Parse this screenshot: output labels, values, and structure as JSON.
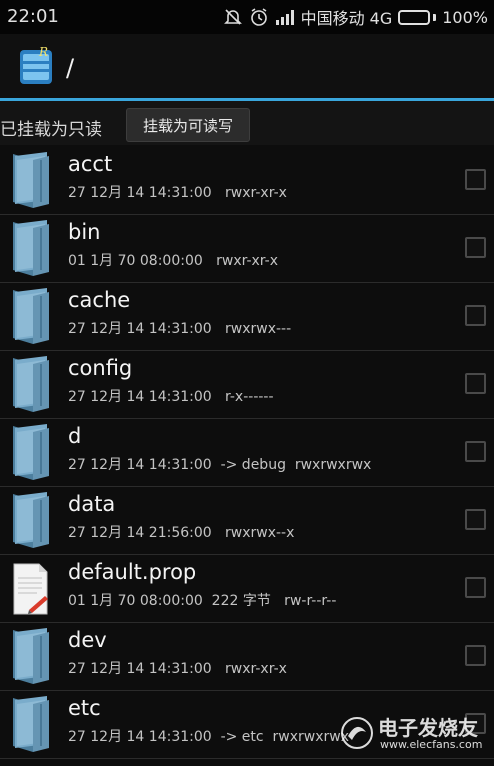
{
  "status_bar": {
    "time": "22:01",
    "carrier": "中国移动 4G",
    "battery": "100%",
    "battery_level": 1.0,
    "battery_color": "#3ad43a",
    "icons": [
      "no-alarm-icon",
      "clock-icon",
      "signal-icon",
      "battery-icon"
    ]
  },
  "title_bar": {
    "path": "/",
    "app_icon": "root-explorer-app-icon"
  },
  "mount_bar": {
    "status": "已挂载为只读",
    "button": "挂载为可读写"
  },
  "files": [
    {
      "name": "acct",
      "meta": "27 12月 14 14:31:00   rwxr-xr-x",
      "icon": "folder-icon"
    },
    {
      "name": "bin",
      "meta": "01 1月 70 08:00:00   rwxr-xr-x",
      "icon": "folder-icon"
    },
    {
      "name": "cache",
      "meta": "27 12月 14 14:31:00   rwxrwx---",
      "icon": "folder-icon"
    },
    {
      "name": "config",
      "meta": "27 12月 14 14:31:00   r-x------",
      "icon": "folder-icon"
    },
    {
      "name": "d",
      "meta": "27 12月 14 14:31:00  -> debug  rwxrwxrwx",
      "icon": "folder-icon"
    },
    {
      "name": "data",
      "meta": "27 12月 14 21:56:00   rwxrwx--x",
      "icon": "folder-icon"
    },
    {
      "name": "default.prop",
      "meta": "01 1月 70 08:00:00  222 字节   rw-r--r--",
      "icon": "file-icon"
    },
    {
      "name": "dev",
      "meta": "27 12月 14 14:31:00   rwxr-xr-x",
      "icon": "folder-icon"
    },
    {
      "name": "etc",
      "meta": "27 12月 14 14:31:00  -> etc  rwxrwxrwx",
      "icon": "folder-icon"
    }
  ],
  "watermark": {
    "text": "电子发烧友",
    "url": "www.elecfans.com"
  },
  "colors": {
    "accent": "#3aa6dc",
    "folder": "#6f9fbc",
    "background": "#0d0d0d"
  }
}
